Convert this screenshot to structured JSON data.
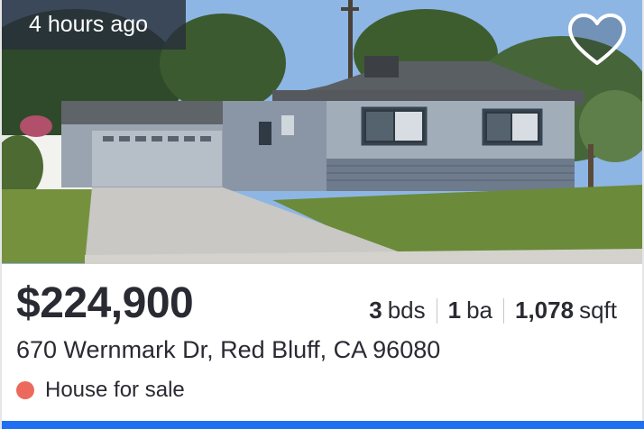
{
  "listing": {
    "time_badge": "4 hours ago",
    "favorite_icon": "heart-outline-icon",
    "price": "$224,900",
    "beds_value": "3",
    "beds_unit": "bds",
    "baths_value": "1",
    "baths_unit": "ba",
    "sqft_value": "1,078",
    "sqft_unit": "sqft",
    "address": "670 Wernmark Dr, Red Bluff, CA 96080",
    "status_label": "House for sale",
    "status_color": "#ec6a5c"
  },
  "theme": {
    "text_color": "#2a2a33",
    "accent_bar_color": "#1f6ff2"
  }
}
